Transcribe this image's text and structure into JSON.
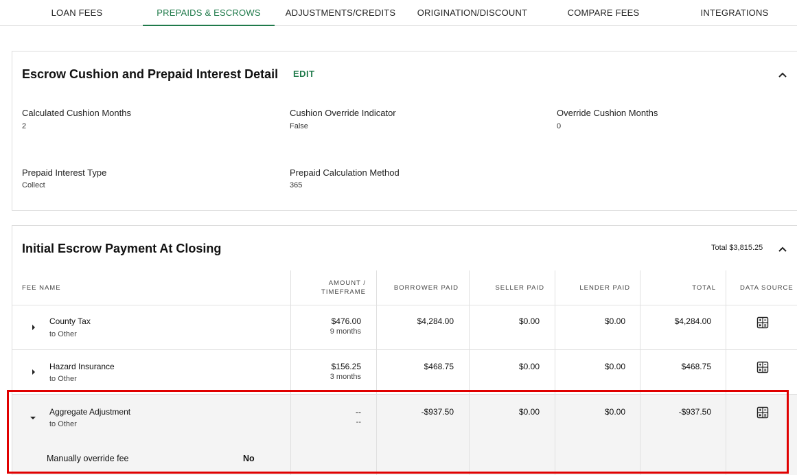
{
  "tabs": [
    {
      "label": "LOAN FEES"
    },
    {
      "label": "PREPAIDS & ESCROWS"
    },
    {
      "label": "ADJUSTMENTS/CREDITS"
    },
    {
      "label": "ORIGINATION/DISCOUNT"
    },
    {
      "label": "COMPARE FEES"
    },
    {
      "label": "INTEGRATIONS"
    }
  ],
  "escrow_detail": {
    "title": "Escrow Cushion and Prepaid Interest Detail",
    "edit_label": "EDIT",
    "fields": [
      {
        "label": "Calculated Cushion Months",
        "value": "2"
      },
      {
        "label": "Cushion Override Indicator",
        "value": "False"
      },
      {
        "label": "Override Cushion Months",
        "value": "0"
      },
      {
        "label": "Prepaid Interest Type",
        "value": "Collect"
      },
      {
        "label": "Prepaid Calculation Method",
        "value": "365"
      }
    ]
  },
  "initial_escrow": {
    "title": "Initial Escrow Payment At Closing",
    "total_label": "Total",
    "total_value": "$3,815.25",
    "columns": {
      "fee_name": "FEE NAME",
      "amount_line1": "AMOUNT /",
      "amount_line2": "TIMEFRAME",
      "borrower_paid": "BORROWER PAID",
      "seller_paid": "SELLER PAID",
      "lender_paid": "LENDER PAID",
      "total": "TOTAL",
      "data_source": "DATA SOURCE"
    },
    "rows": [
      {
        "name": "County Tax",
        "to": "to Other",
        "amount": "$476.00",
        "timeframe": "9 months",
        "borrower": "$4,284.00",
        "seller": "$0.00",
        "lender": "$0.00",
        "total": "$4,284.00"
      },
      {
        "name": "Hazard Insurance",
        "to": "to Other",
        "amount": "$156.25",
        "timeframe": "3 months",
        "borrower": "$468.75",
        "seller": "$0.00",
        "lender": "$0.00",
        "total": "$468.75"
      },
      {
        "name": "Aggregate Adjustment",
        "to": "to Other",
        "amount": "--",
        "timeframe": "--",
        "borrower": "-$937.50",
        "seller": "$0.00",
        "lender": "$0.00",
        "total": "-$937.50"
      }
    ],
    "expanded": {
      "label": "Manually override fee",
      "value": "No"
    }
  },
  "icons": {
    "collapse": "chevron-up-icon",
    "expand_collapsed": "caret-right-icon",
    "expand_open": "caret-down-icon",
    "data_source": "calculator-icon"
  },
  "colors": {
    "accent": "#1f7a4a",
    "highlight": "#e00000"
  }
}
